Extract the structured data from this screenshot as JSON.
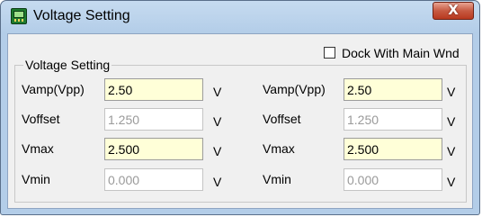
{
  "window": {
    "title": "Voltage Setting",
    "close_glyph": "X",
    "icon": "oscilloscope-icon"
  },
  "dock": {
    "label": "Dock With Main Wnd",
    "checked": false
  },
  "group": {
    "title": "Voltage Setting"
  },
  "left": {
    "vamp_label": "Vamp(Vpp)",
    "vamp_value": "2.50",
    "voffset_label": "Voffset",
    "voffset_value": "1.250",
    "vmax_label": "Vmax",
    "vmax_value": "2.500",
    "vmin_label": "Vmin",
    "vmin_value": "0.000"
  },
  "right": {
    "vamp_label": "Vamp(Vpp)",
    "vamp_value": "2.50",
    "voffset_label": "Voffset",
    "voffset_value": "1.250",
    "vmax_label": "Vmax",
    "vmax_value": "2.500",
    "vmin_label": "Vmin",
    "vmin_value": "0.000"
  },
  "unit": "V",
  "colors": {
    "enabled_field_bg": "#ffffd8",
    "disabled_text": "#9a9a9a",
    "close_button": "#c75a42"
  }
}
